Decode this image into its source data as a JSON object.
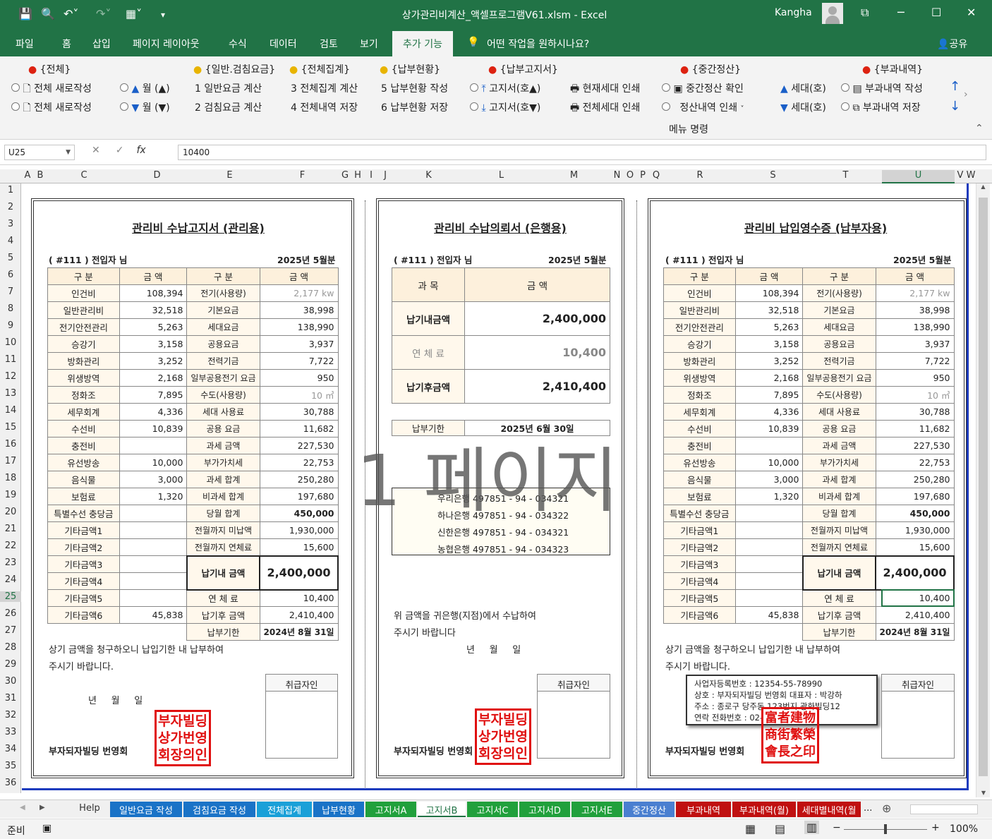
{
  "app": {
    "title": "상가관리비계산_액셀프로그램V61.xlsm  -  Excel",
    "user": "Kangha"
  },
  "ribbon_tabs": [
    "파일",
    "홈",
    "삽입",
    "페이지 레이아웃",
    "수식",
    "데이터",
    "검토",
    "보기",
    "추가 기능",
    "어떤 작업을 원하시나요?",
    "공유"
  ],
  "ribbon": {
    "groups": [
      "{전체}",
      "{일반.검침요금}",
      "{전체집계}",
      "{납부현황}",
      "{납부고지서}",
      "{중간정산}",
      "{부과내역}"
    ],
    "row1": [
      "전체 새로작성",
      "월 (▲)",
      "1  일반요금 계산",
      "3  전체집계 계산",
      "5  납부현황 작성",
      "고지서(호▲)",
      "현재세대 인쇄",
      "중간정산 확인",
      "세대(호)",
      "부과내역 작성"
    ],
    "row2": [
      "전체 새로작성",
      "월 (▼)",
      "2  검침요금 계산",
      "4  전체내역 저장",
      "6  납부현황 저장",
      "고지서(호▼)",
      "전체세대 인쇄",
      "정산내역 인쇄",
      "세대(호)",
      "부과내역 저장"
    ],
    "footer": "메뉴 명령"
  },
  "namebox": "U25",
  "formula": "10400",
  "columns": [
    "A",
    "B",
    "C",
    "D",
    "E",
    "F",
    "G",
    "H",
    "I",
    "J",
    "K",
    "L",
    "M",
    "N",
    "O",
    "P",
    "Q",
    "R",
    "S",
    "T",
    "U",
    "V",
    "W"
  ],
  "rows": [
    "1",
    "2",
    "3",
    "4",
    "5",
    "6",
    "7",
    "8",
    "9",
    "10",
    "11",
    "12",
    "13",
    "14",
    "15",
    "16",
    "17",
    "18",
    "19",
    "20",
    "21",
    "22",
    "23",
    "24",
    "25",
    "26",
    "27",
    "28",
    "29",
    "30",
    "31",
    "32",
    "33",
    "34",
    "35",
    "36"
  ],
  "notice": {
    "title1": "관리비 수납고지서 (관리용)",
    "title3": "관리비 납입영수증 (납부자용)",
    "addressee": "( #111 )  전입자 님",
    "period": "2025년 5월분",
    "hdr": [
      "구  분",
      "금  액",
      "구  분",
      "금  액"
    ],
    "left": [
      [
        "인건비",
        "108,394"
      ],
      [
        "일반관리비",
        "32,518"
      ],
      [
        "전기안전관리",
        "5,263"
      ],
      [
        "승강기",
        "3,158"
      ],
      [
        "방화관리",
        "3,252"
      ],
      [
        "위생방역",
        "2,168"
      ],
      [
        "정화조",
        "7,895"
      ],
      [
        "세무회계",
        "4,336"
      ],
      [
        "수선비",
        "10,839"
      ],
      [
        "충전비",
        ""
      ],
      [
        "유선방송",
        "10,000"
      ],
      [
        "음식물",
        "3,000"
      ],
      [
        "보험료",
        "1,320"
      ],
      [
        "특별수선 충당금",
        ""
      ],
      [
        "기타금액1",
        ""
      ],
      [
        "기타금액2",
        ""
      ],
      [
        "기타금액3",
        ""
      ],
      [
        "기타금액4",
        ""
      ],
      [
        "기타금액5",
        ""
      ],
      [
        "기타금액6",
        "45,838"
      ]
    ],
    "right": [
      [
        "전기(사용량)",
        "2,177  kw"
      ],
      [
        "기본요금",
        "38,998"
      ],
      [
        "세대요금",
        "138,990"
      ],
      [
        "공용요금",
        "3,937"
      ],
      [
        "전력기금",
        "7,722"
      ],
      [
        "일부공용전기 요금",
        "950"
      ],
      [
        "수도(사용량)",
        "10  ㎥"
      ],
      [
        "세대 사용료",
        "30,788"
      ],
      [
        "공용 요금",
        "11,682"
      ],
      [
        "과세 금액",
        "227,530"
      ],
      [
        "부가가치세",
        "22,753"
      ],
      [
        "과세 합계",
        "250,280"
      ],
      [
        "비과세 합계",
        "197,680"
      ],
      [
        "당월 합계",
        "450,000"
      ],
      [
        "전월까지 미납액",
        "1,930,000"
      ],
      [
        "전월까지 연체료",
        "15,600"
      ]
    ],
    "due_label": "납기내 금액",
    "due_amount": "2,400,000",
    "late_label": "연  체  료",
    "late_amount": "10,400",
    "after_label": "납기후 금액",
    "after_amount": "2,410,400",
    "deadline_label": "납부기한",
    "deadline": "2024년 8월 31일",
    "msg1": "상기 금액을 청구하오니 납입기한 내 납부하여",
    "msg2": "주시기 바랍니다.",
    "date": "년     월     일",
    "handler": "취급자인",
    "org": "부자되자빌딩 번영회",
    "stamp": [
      "부자빌딩",
      "상가번영",
      "회장의인"
    ]
  },
  "bank": {
    "title": "관리비 수납의뢰서 (은행용)",
    "hdr": [
      "과     목",
      "금     액"
    ],
    "rows": [
      [
        "납기내금액",
        "2,400,000"
      ],
      [
        "연  체  료",
        "10,400"
      ],
      [
        "납기후금액",
        "2,410,400"
      ]
    ],
    "deadline_label": "납부기한",
    "deadline": "2025년 6월 30일",
    "accounts": [
      "우리은행  497851  -  94  -  034321",
      "하나은행  497851  -  94  -  034322",
      "신한은행  497851  -  94  -  034321",
      "농협은행  497851  -  94  -  034323"
    ],
    "msg1": "위 금액을 귀은행(지점)에서 수납하여",
    "msg2": "주시기 바랍니다",
    "date": "년     월     일"
  },
  "biz": [
    "사업자등록번호 : 12354-55-78990",
    "상호 : 부자되자빌딩 번영회  대표자 : 박강하",
    "주소 : 종로구 당주동 123번지 광화빌딩12",
    "연락 전화번호 : 02-"
  ],
  "seal": [
    "富者建物",
    "商街繁榮",
    "會長之印"
  ],
  "page_mark": "1 페이지",
  "sheet_tabs": [
    {
      "name": "Help",
      "color": "#f0f0f0",
      "text": "#333"
    },
    {
      "name": "일반요금 작성",
      "color": "#1a73c7",
      "text": "#fff"
    },
    {
      "name": "검침요금 작성",
      "color": "#1a73c7",
      "text": "#fff"
    },
    {
      "name": "전체집계",
      "color": "#1aa0d8",
      "text": "#fff"
    },
    {
      "name": "납부현황",
      "color": "#1a73c7",
      "text": "#fff"
    },
    {
      "name": "고지서A",
      "color": "#21a03c",
      "text": "#fff"
    },
    {
      "name": "고지서B",
      "color": "#ffffff",
      "text": "#217346"
    },
    {
      "name": "고지서C",
      "color": "#21a03c",
      "text": "#fff"
    },
    {
      "name": "고지서D",
      "color": "#21a03c",
      "text": "#fff"
    },
    {
      "name": "고지서E",
      "color": "#21a03c",
      "text": "#fff"
    },
    {
      "name": "중간정산",
      "color": "#4a7fd0",
      "text": "#fff"
    },
    {
      "name": "부과내역",
      "color": "#c01010",
      "text": "#fff"
    },
    {
      "name": "부과내역(월)",
      "color": "#c01010",
      "text": "#fff"
    },
    {
      "name": "세대별내역(월",
      "color": "#c01010",
      "text": "#fff"
    }
  ],
  "status": {
    "ready": "준비",
    "zoom": "100%"
  }
}
